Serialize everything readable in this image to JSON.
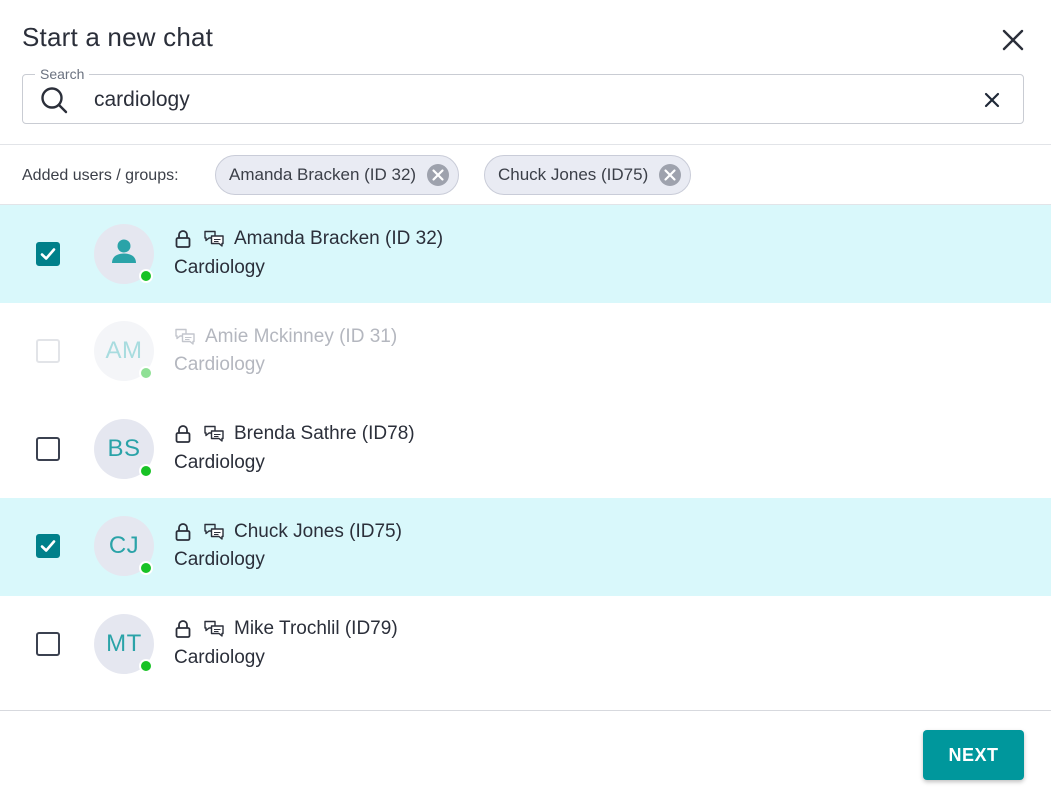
{
  "dialog": {
    "title": "Start a new chat",
    "close_icon": "close-icon"
  },
  "search": {
    "legend": "Search",
    "value": "cardiology",
    "icon": "search-icon",
    "clear_icon": "clear-icon"
  },
  "added": {
    "label": "Added users / groups:",
    "chips": [
      {
        "label": "Amanda Bracken (ID 32)"
      },
      {
        "label": "Chuck Jones (ID75)"
      }
    ]
  },
  "users": [
    {
      "name": "Amanda Bracken (ID 32)",
      "department": "Cardiology",
      "initials": "",
      "avatar_icon": "person-icon",
      "checked": true,
      "disabled": false,
      "online": true,
      "locked": true
    },
    {
      "name": "Amie Mckinney (ID 31)",
      "department": "Cardiology",
      "initials": "AM",
      "checked": false,
      "disabled": true,
      "online": true,
      "locked": false
    },
    {
      "name": "Brenda Sathre (ID78)",
      "department": "Cardiology",
      "initials": "BS",
      "checked": false,
      "disabled": false,
      "online": true,
      "locked": true
    },
    {
      "name": "Chuck Jones (ID75)",
      "department": "Cardiology",
      "initials": "CJ",
      "checked": true,
      "disabled": false,
      "online": true,
      "locked": true
    },
    {
      "name": "Mike Trochlil (ID79)",
      "department": "Cardiology",
      "initials": "MT",
      "checked": false,
      "disabled": false,
      "online": true,
      "locked": true
    }
  ],
  "footer": {
    "next_label": "NEXT"
  },
  "colors": {
    "accent": "#00979c",
    "checkbox_checked": "#00808a",
    "selected_row": "#d9f8fb",
    "online": "#18c225"
  }
}
